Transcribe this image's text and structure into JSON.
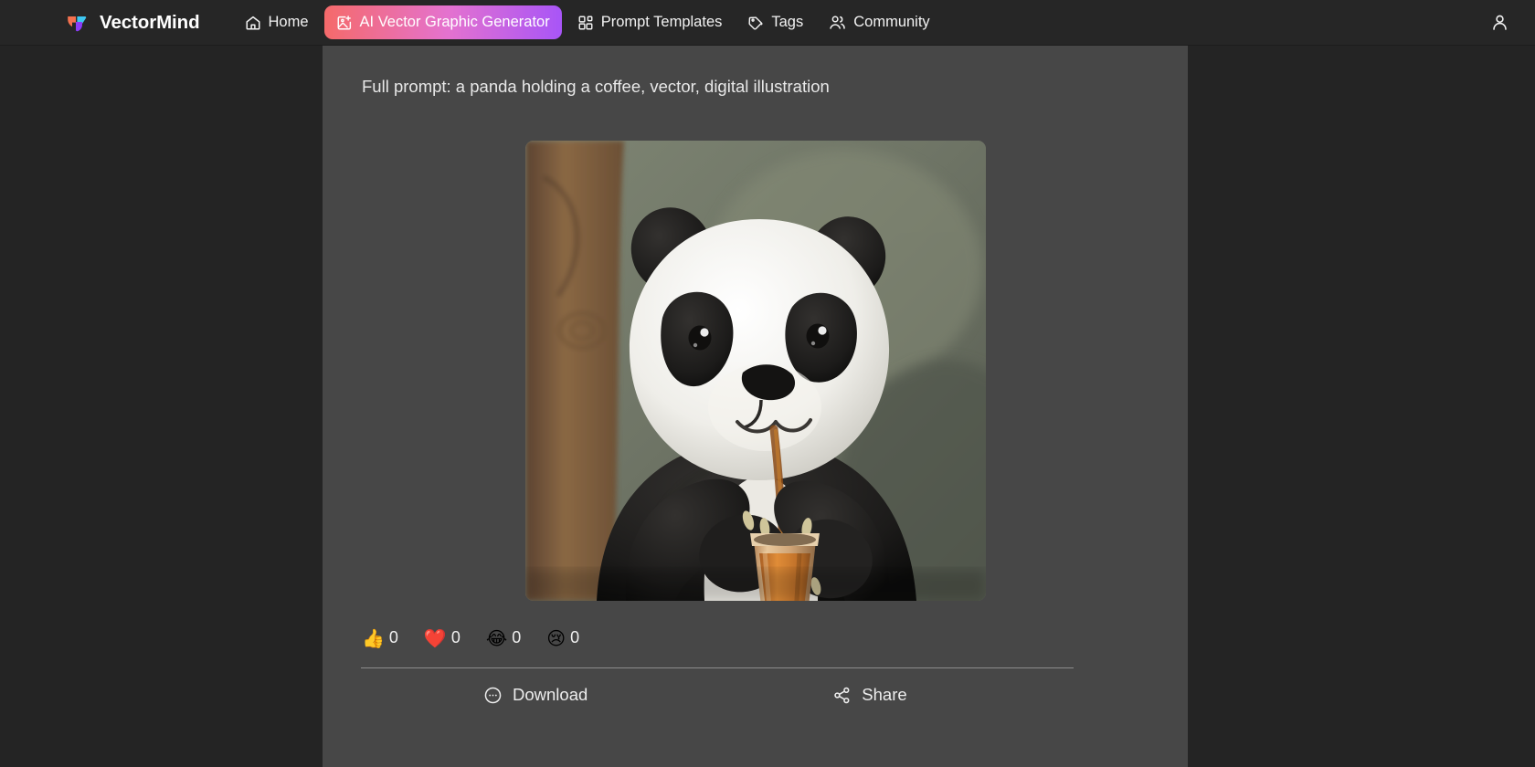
{
  "navbar": {
    "brand": {
      "name": "VectorMind",
      "logo_icon": "vectormind-logo-icon",
      "colors": {
        "orange": "#f4714f",
        "blue": "#3ec6f0",
        "purple": "#8b3dfa"
      }
    },
    "items": [
      {
        "label": "Home",
        "icon": "home-icon",
        "active": false
      },
      {
        "label": "AI Vector Graphic Generator",
        "icon": "image-plus-icon",
        "active": true
      },
      {
        "label": "Prompt Templates",
        "icon": "layout-grid-icon",
        "active": false
      },
      {
        "label": "Tags",
        "icon": "tag-icon",
        "active": false
      },
      {
        "label": "Community",
        "icon": "users-icon",
        "active": false
      }
    ],
    "account": {
      "icon": "user-icon",
      "label": "Account"
    },
    "active_gradient": {
      "from": "#f56a6a",
      "via": "#e472cf",
      "to": "#a855f7"
    }
  },
  "main": {
    "prompt_label": "Full prompt: a panda holding a coffee, vector, digital illustration",
    "artwork": {
      "alt": "a panda holding a coffee, vector, digital illustration",
      "name": "generated-image"
    },
    "reactions": [
      {
        "name": "reaction-thumbs-up",
        "emoji": "👍",
        "count": "0"
      },
      {
        "name": "reaction-heart",
        "emoji": "❤️",
        "count": "0"
      },
      {
        "name": "reaction-joy",
        "emoji": "😂",
        "count": "0"
      },
      {
        "name": "reaction-sad",
        "emoji": "😢",
        "count": "0"
      }
    ],
    "actions": [
      {
        "label": "Download",
        "icon": "ellipsis-circle-icon"
      },
      {
        "label": "Share",
        "icon": "share-nodes-icon"
      }
    ]
  },
  "theme": {
    "page_background": "#242424",
    "panel_background": "#474747",
    "navbar_background": "#262626",
    "text_primary": "#f2f2f2",
    "divider": "#8d8d8d"
  }
}
